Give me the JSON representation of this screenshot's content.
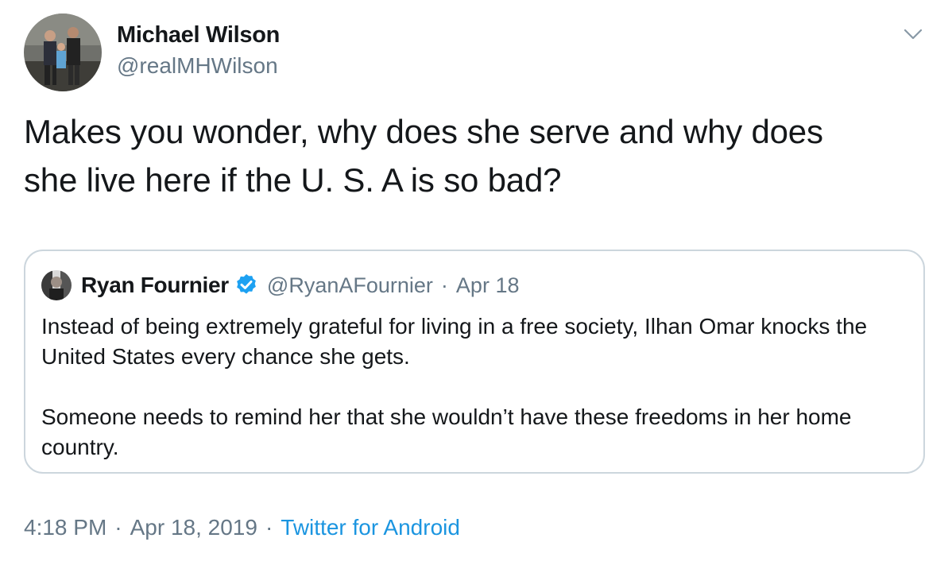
{
  "author": {
    "name": "Michael Wilson",
    "handle": "@realMHWilson"
  },
  "tweet": {
    "text_line1": "Makes you wonder, why does she serve and why does",
    "text_line2": "she live here if the U. S. A is so bad?"
  },
  "quoted_tweet": {
    "name": "Ryan Fournier",
    "handle": "@RyanAFournier",
    "separator": "·",
    "date": "Apr 18",
    "paragraph1": "Instead of being extremely grateful for living in a free society, Ilhan Omar knocks the United States every chance she gets.",
    "paragraph2": "Someone needs to remind her that she wouldn’t have these freedoms in her home country."
  },
  "meta": {
    "time": "4:18 PM",
    "separator": "·",
    "date": "Apr 18, 2019",
    "source": "Twitter for Android"
  },
  "colors": {
    "text": "#14171a",
    "secondary": "#657786",
    "link": "#1b95e0",
    "border": "#ccd6dd",
    "verified": "#1da1f2"
  },
  "icons": {
    "menu": "chevron-down-icon",
    "verified": "verified-badge-icon"
  }
}
